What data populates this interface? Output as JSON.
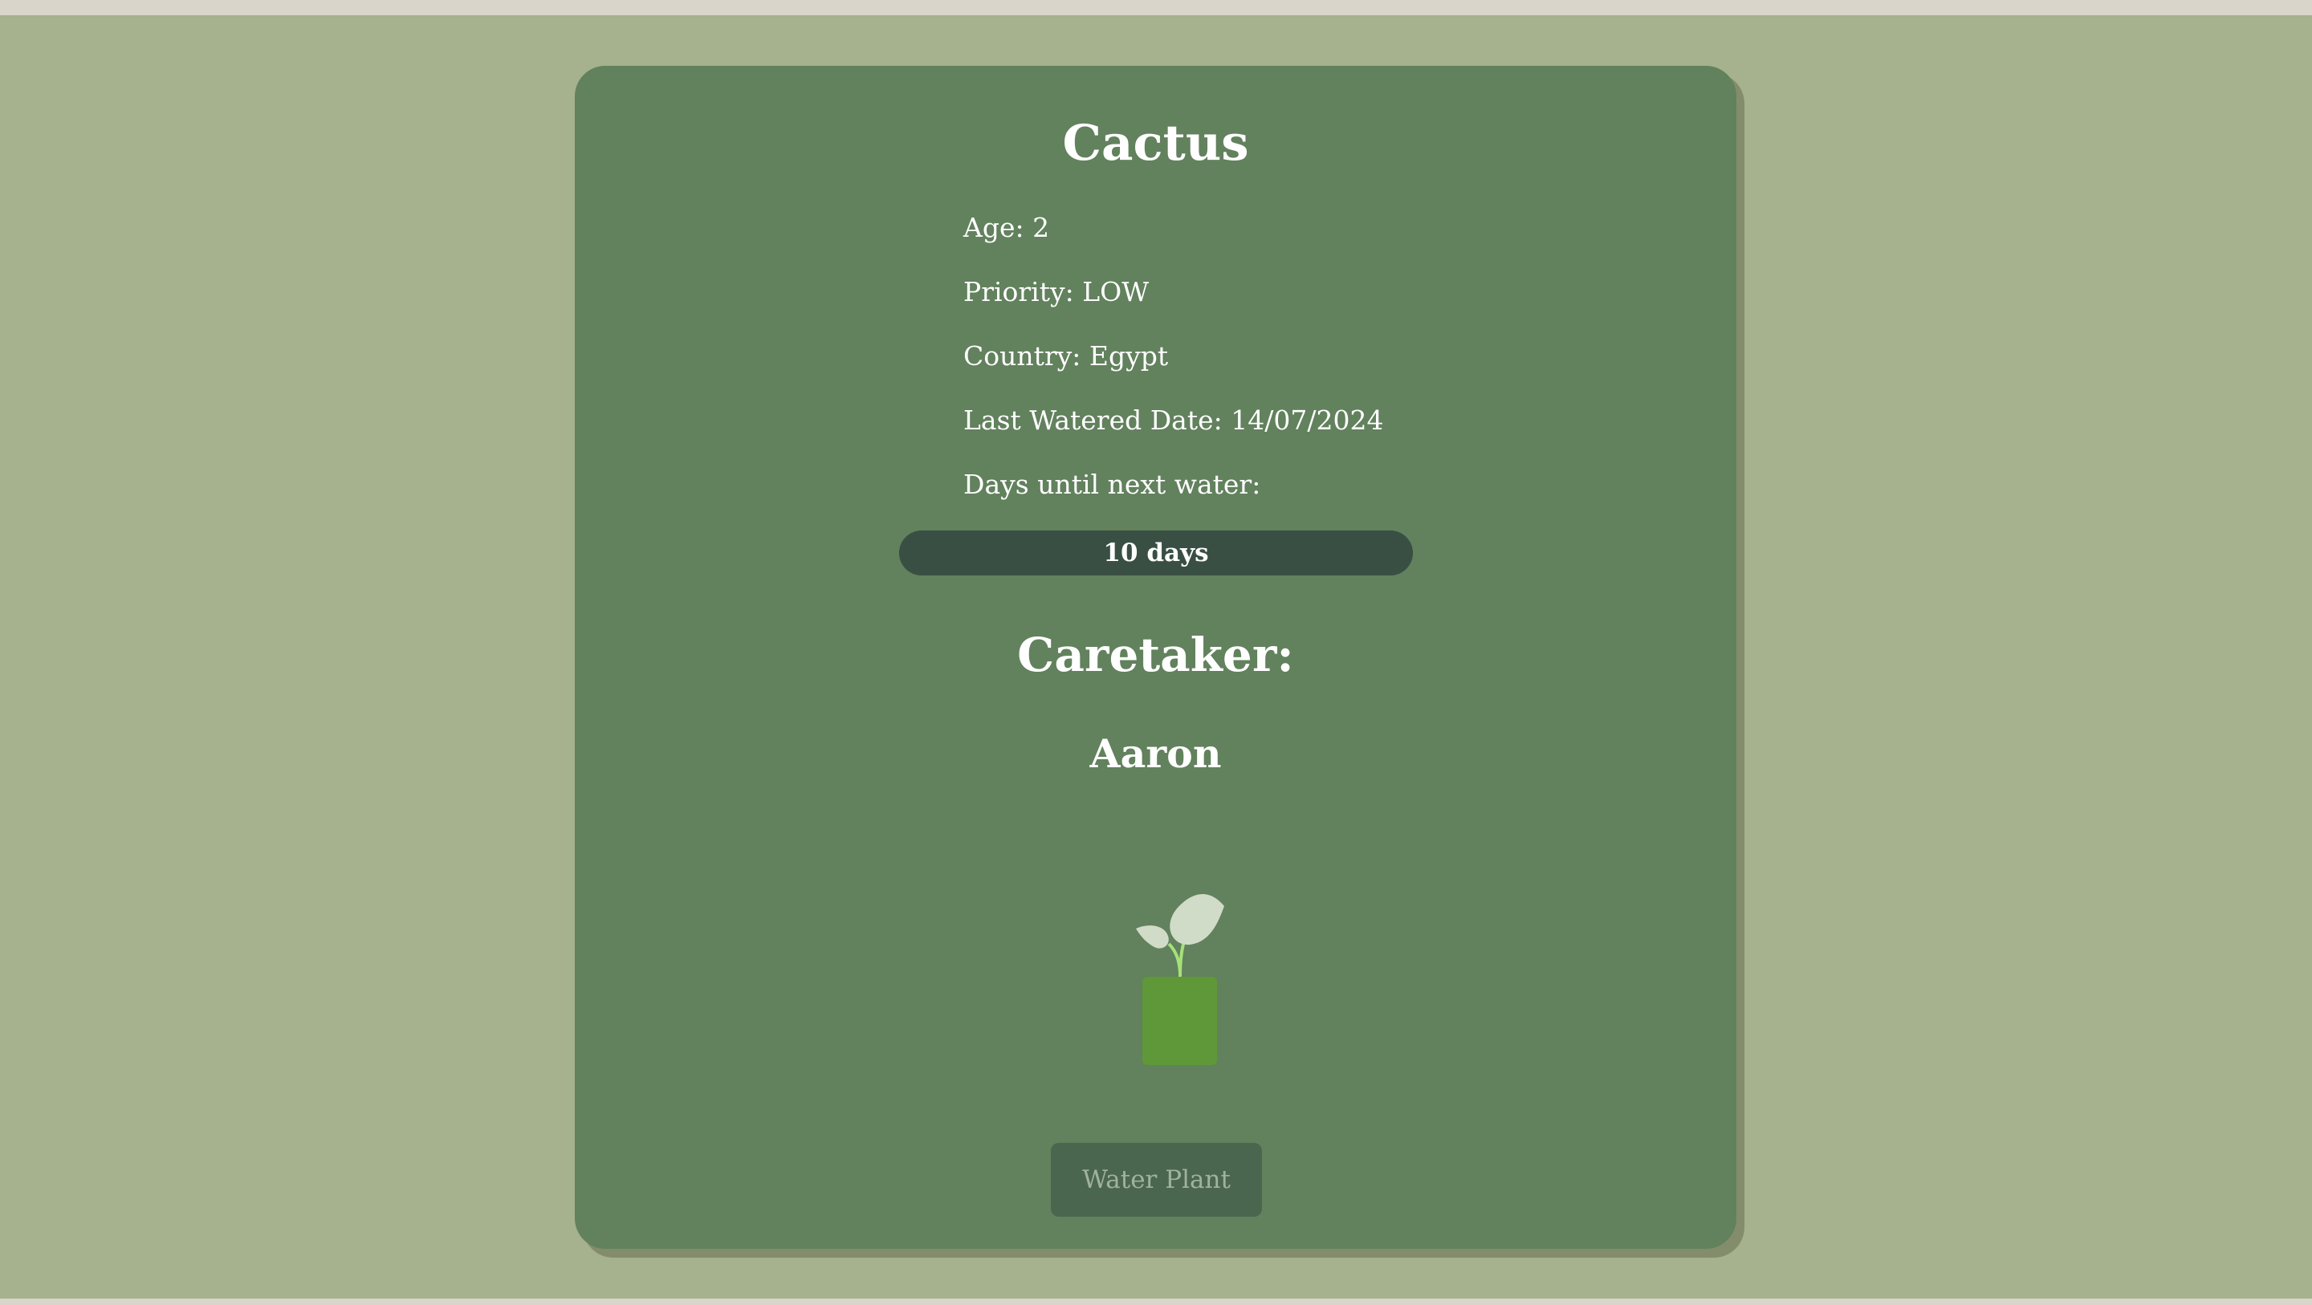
{
  "plant": {
    "name": "Cactus",
    "age_line": "Age: 2",
    "priority_line": "Priority: LOW",
    "country_line": "Country: Egypt",
    "last_watered_line": "Last Watered Date: 14/07/2024",
    "days_label": "Days until next water:",
    "water_bar": {
      "label": "10 days",
      "fill_fraction": 1.0
    }
  },
  "caretaker": {
    "heading": "Caretaker:",
    "name": "Aaron"
  },
  "illustration": {
    "icon": "seedling-in-pot-icon"
  },
  "actions": {
    "water_label": "Water Plant"
  },
  "colors": {
    "page_background": "#a5b28d",
    "card_background": "#62815d",
    "card_shadow": "#838c6b",
    "water_bar": "#3a4f43",
    "button_background": "#4b664f",
    "button_text": "#a0b29c",
    "pot": "#5f9838",
    "leaf": "#d0dbc8",
    "stem": "#a6e07a"
  }
}
